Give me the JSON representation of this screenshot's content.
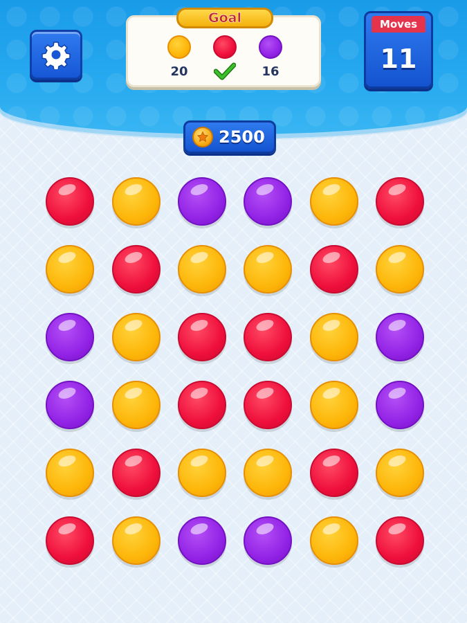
{
  "colors": {
    "red": "#ef0f3c",
    "yellow": "#fdb609",
    "purple": "#9323e6",
    "header_blue": "#27aaf0",
    "button_blue": "#1757d6",
    "moves_red": "#e5334b",
    "check_green": "#3bbf2a"
  },
  "settings": {
    "icon": "gear-icon"
  },
  "goal": {
    "title": "Goal",
    "items": [
      {
        "color": "yellow",
        "count": "20",
        "completed": false
      },
      {
        "color": "red",
        "count": "",
        "completed": true,
        "icon": "checkmark-icon"
      },
      {
        "color": "purple",
        "count": "16",
        "completed": false
      }
    ]
  },
  "moves": {
    "label": "Moves",
    "value": "11"
  },
  "coins": {
    "icon": "coin-star-icon",
    "value": "2500"
  },
  "board": {
    "rows": 6,
    "cols": 6,
    "cells": [
      [
        "red",
        "yellow",
        "purple",
        "purple",
        "yellow",
        "red"
      ],
      [
        "yellow",
        "red",
        "yellow",
        "yellow",
        "red",
        "yellow"
      ],
      [
        "purple",
        "yellow",
        "red",
        "red",
        "yellow",
        "purple"
      ],
      [
        "purple",
        "yellow",
        "red",
        "red",
        "yellow",
        "purple"
      ],
      [
        "yellow",
        "red",
        "yellow",
        "yellow",
        "red",
        "yellow"
      ],
      [
        "red",
        "yellow",
        "purple",
        "purple",
        "yellow",
        "red"
      ]
    ]
  }
}
